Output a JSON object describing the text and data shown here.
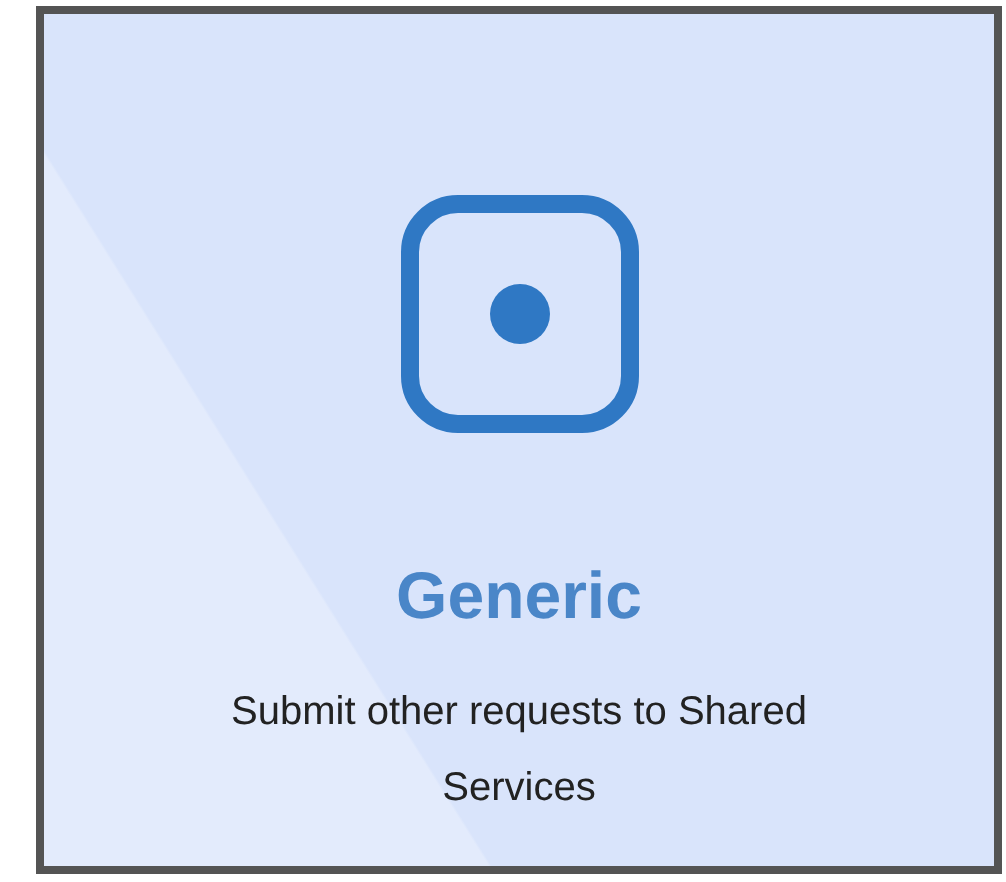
{
  "tile": {
    "title": "Generic",
    "description": "Submit other requests to Shared Services"
  }
}
